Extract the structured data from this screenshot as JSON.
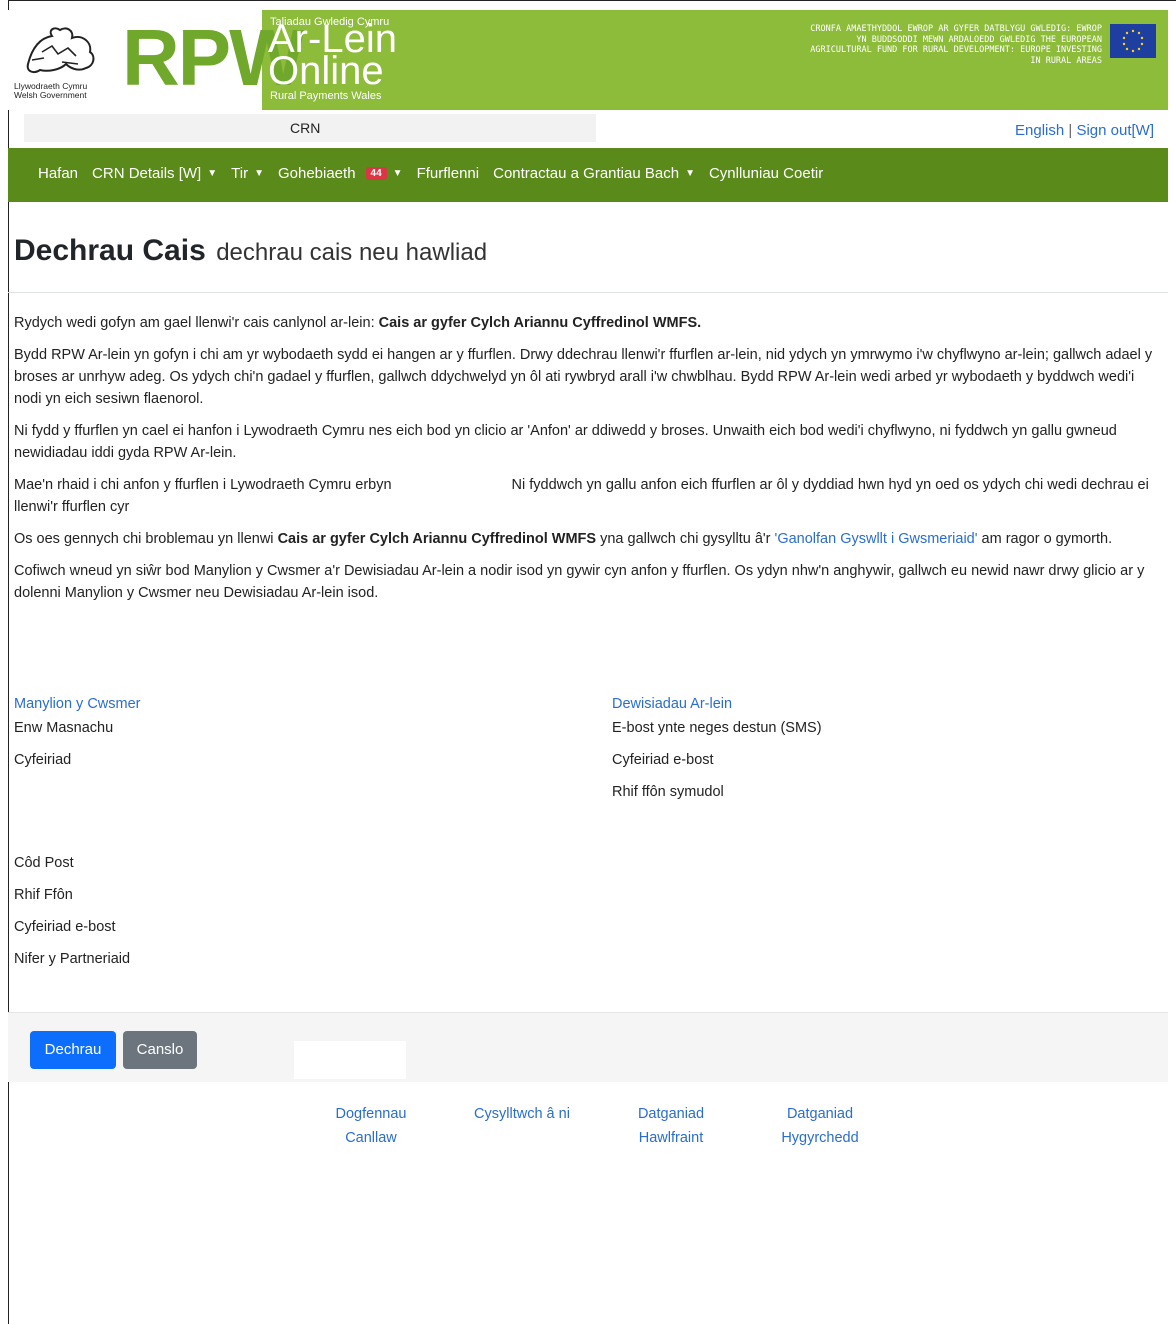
{
  "header": {
    "wg_logo_text": [
      "Llywodraeth Cymru",
      "Welsh Government"
    ],
    "rpw": "RPW",
    "small_title": "Taliadau Gwledig Cymru",
    "arlein": "Ar-Lein",
    "online": "Online",
    "subtitle": "Rural Payments Wales",
    "eu_text": "CRONFA AMAETHYDDOL EWROP AR GYFER DATBLYGU GWLEDIG: EWROP YN BUDDSODDI MEWN ARDALOEDD GWLEDIG THE EUROPEAN AGRICULTURAL FUND FOR RURAL DEVELOPMENT: EUROPE INVESTING IN RURAL AREAS",
    "eu_flag_icon": "eu-flag-icon"
  },
  "utility": {
    "crn_label": "CRN",
    "english_link": "English",
    "separator": "|",
    "signout_link": "Sign out[W]"
  },
  "nav": {
    "items": [
      {
        "label": "Hafan",
        "dropdown": false
      },
      {
        "label": "CRN Details [W]",
        "dropdown": true
      },
      {
        "label": "Tir",
        "dropdown": true
      },
      {
        "label": "Gohebiaeth",
        "dropdown": true,
        "badge": "44"
      },
      {
        "label": "Ffurflenni",
        "dropdown": false
      },
      {
        "label": "Contractau a Grantiau Bach",
        "dropdown": true
      },
      {
        "label": "Cynlluniau Coetir",
        "dropdown": false
      }
    ]
  },
  "page": {
    "title": "Dechrau Cais",
    "subtitle": "dechrau cais neu hawliad",
    "p1_text": "Rydych wedi gofyn am gael llenwi'r cais canlynol ar-lein: ",
    "p1_bold": "Cais ar gyfer Cylch Ariannu Cyffredinol WMFS.",
    "p2": "Bydd RPW Ar-lein yn gofyn i chi am yr wybodaeth sydd ei hangen ar y ffurflen. Drwy ddechrau llenwi'r ffurflen ar-lein, nid ydych yn ymrwymo i'w chyflwyno ar-lein; gallwch adael y broses ar unrhyw adeg. Os ydych chi'n gadael y ffurflen, gallwch ddychwelyd yn ôl ati rywbryd arall i'w chwblhau. Bydd RPW Ar-lein wedi arbed yr wybodaeth y byddwch wedi'i nodi yn eich sesiwn flaenorol.",
    "p3": "Ni fydd y ffurflen yn cael ei hanfon i Lywodraeth Cymru nes eich bod yn clicio ar 'Anfon' ar ddiwedd y broses. Unwaith eich bod wedi'i chyflwyno, ni fyddwch yn gallu gwneud newidiadau iddi gyda RPW Ar-lein.",
    "p4_part1": "Mae'n rhaid i chi anfon y ffurflen i Lywodraeth Cymru erbyn",
    "p4_part2": "Ni fyddwch yn gallu anfon eich ffurflen ar ôl y dyddiad hwn hyd yn oed os ydych chi wedi dechrau ei llenwi'r ffurflen cyr",
    "p5_part1": "Os oes gennych chi broblemau yn llenwi ",
    "p5_bold": "Cais ar gyfer Cylch Ariannu Cyffredinol WMFS",
    "p5_part2": " yna gallwch chi gysylltu â'r ",
    "p5_link": "'Ganolfan Gyswllt i Gwsmeriaid'",
    "p5_part3": " am ragor o gymorth.",
    "p6": "Cofiwch wneud yn siŵr bod Manylion y Cwsmer a'r Dewisiadau Ar-lein a nodir isod yn gywir cyn anfon y ffurflen. Os ydyn nhw'n anghywir, gallwch eu newid nawr drwy glicio ar y dolenni Manylion y Cwsmer neu Dewisiadau Ar-lein isod."
  },
  "customer_details": {
    "link": "Manylion y Cwsmer",
    "fields": [
      "Enw Masnachu",
      "Cyfeiriad",
      "Côd Post",
      "Rhif Ffôn",
      "Cyfeiriad e-bost",
      "Nifer y Partneriaid"
    ]
  },
  "online_options": {
    "link": "Dewisiadau Ar-lein",
    "fields": [
      "E-bost ynte neges destun (SMS)",
      "Cyfeiriad e-bost",
      "Rhif ffôn symudol"
    ]
  },
  "buttons": {
    "start": "Dechrau",
    "cancel": "Canslo"
  },
  "footer": {
    "links": [
      [
        "Dogfennau",
        "Canllaw"
      ],
      [
        "Cysylltwch â ni"
      ],
      [
        "Datganiad",
        "Hawlfraint"
      ],
      [
        "Datganiad",
        "Hygyrchedd"
      ]
    ]
  }
}
